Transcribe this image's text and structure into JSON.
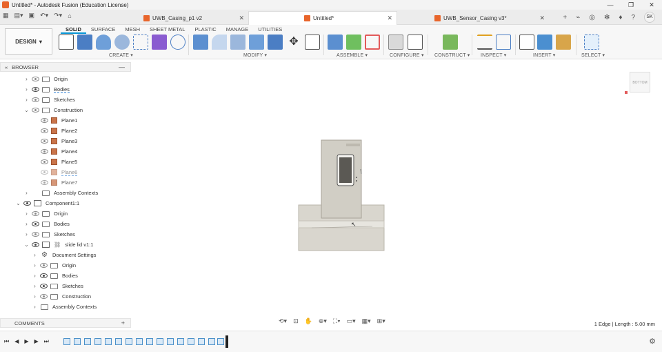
{
  "window": {
    "title": "Untitled* - Autodesk Fusion (Education License)",
    "controls": [
      "—",
      "❐",
      "✕"
    ]
  },
  "doc_tabs": [
    {
      "label": "UWB_Casing_p1 v2"
    },
    {
      "label": "Untitled*"
    },
    {
      "label": "UWB_Sensor_Casing v3*"
    }
  ],
  "user": {
    "initials": "SK"
  },
  "ribbon": {
    "workspace": "DESIGN",
    "tabs": [
      "SOLID",
      "SURFACE",
      "MESH",
      "SHEET METAL",
      "PLASTIC",
      "MANAGE",
      "UTILITIES"
    ],
    "groups": [
      "CREATE",
      "MODIFY",
      "ASSEMBLE",
      "CONFIGURE",
      "CONSTRUCT",
      "INSPECT",
      "INSERT",
      "SELECT"
    ]
  },
  "browser": {
    "title": "BROWSER",
    "items": [
      {
        "label": "Origin"
      },
      {
        "label": "Bodies"
      },
      {
        "label": "Sketches"
      },
      {
        "label": "Construction"
      },
      {
        "label": "Plane1"
      },
      {
        "label": "Plane2"
      },
      {
        "label": "Plane3"
      },
      {
        "label": "Plane4"
      },
      {
        "label": "Plane5"
      },
      {
        "label": "Plane6"
      },
      {
        "label": "Plane7"
      },
      {
        "label": "Assembly Contexts"
      },
      {
        "label": "Component1:1"
      },
      {
        "label": "Origin"
      },
      {
        "label": "Bodies"
      },
      {
        "label": "Sketches"
      },
      {
        "label": "slide lid v1:1"
      },
      {
        "label": "Document Settings"
      },
      {
        "label": "Origin"
      },
      {
        "label": "Bodies"
      },
      {
        "label": "Sketches"
      },
      {
        "label": "Construction"
      },
      {
        "label": "Assembly Contexts"
      }
    ]
  },
  "comments": {
    "label": "COMMENTS"
  },
  "status": {
    "text": "1 Edge | Length : 5.00 mm"
  },
  "viewcube": {
    "label": "BOTTOM"
  },
  "colors": {
    "accent": "#0696d7",
    "brand": "#e8652b",
    "model": "#d9d6ce"
  }
}
